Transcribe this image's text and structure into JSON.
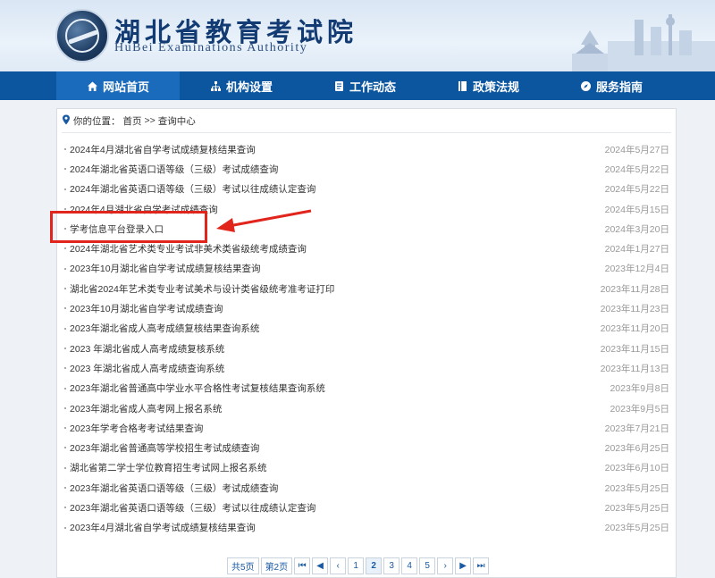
{
  "header": {
    "title": "湖北省教育考试院",
    "subtitle": "HuBei Examinations Authority"
  },
  "nav": {
    "items": [
      {
        "label": "网站首页",
        "icon": "home-icon"
      },
      {
        "label": "机构设置",
        "icon": "org-chart-icon"
      },
      {
        "label": "工作动态",
        "icon": "document-icon"
      },
      {
        "label": "政策法规",
        "icon": "book-icon"
      },
      {
        "label": "服务指南",
        "icon": "compass-icon"
      }
    ],
    "active_index": 0
  },
  "breadcrumb": {
    "prefix": "你的位置：",
    "home": "首页",
    "separator": ">>",
    "current": "查询中心"
  },
  "list": [
    {
      "title": "2024年4月湖北省自学考试成绩复核结果查询",
      "date": "2024年5月27日"
    },
    {
      "title": "2024年湖北省英语口语等级（三级）考试成绩查询",
      "date": "2024年5月22日"
    },
    {
      "title": "2024年湖北省英语口语等级（三级）考试以往成绩认定查询",
      "date": "2024年5月22日"
    },
    {
      "title": "2024年4月湖北省自学考试成绩查询",
      "date": "2024年5月15日"
    },
    {
      "title": "学考信息平台登录入口",
      "date": "2024年3月20日"
    },
    {
      "title": "2024年湖北省艺术类专业考试非美术类省级统考成绩查询",
      "date": "2024年1月27日"
    },
    {
      "title": "2023年10月湖北省自学考试成绩复核结果查询",
      "date": "2023年12月4日"
    },
    {
      "title": "湖北省2024年艺术类专业考试美术与设计类省级统考准考证打印",
      "date": "2023年11月28日"
    },
    {
      "title": "2023年10月湖北省自学考试成绩查询",
      "date": "2023年11月23日"
    },
    {
      "title": "2023年湖北省成人高考成绩复核结果查询系统",
      "date": "2023年11月20日"
    },
    {
      "title": "2023 年湖北省成人高考成绩复核系统",
      "date": "2023年11月15日"
    },
    {
      "title": "2023 年湖北省成人高考成绩查询系统",
      "date": "2023年11月13日"
    },
    {
      "title": "2023年湖北省普通高中学业水平合格性考试复核结果查询系统",
      "date": "2023年9月8日"
    },
    {
      "title": "2023年湖北省成人高考网上报名系统",
      "date": "2023年9月5日"
    },
    {
      "title": "2023年学考合格考考试结果查询",
      "date": "2023年7月21日"
    },
    {
      "title": "2023年湖北省普通高等学校招生考试成绩查询",
      "date": "2023年6月25日"
    },
    {
      "title": "湖北省第二学士学位教育招生考试网上报名系统",
      "date": "2023年6月10日"
    },
    {
      "title": "2023年湖北省英语口语等级（三级）考试成绩查询",
      "date": "2023年5月25日"
    },
    {
      "title": "2023年湖北省英语口语等级（三级）考试以往成绩认定查询",
      "date": "2023年5月25日"
    },
    {
      "title": "2023年4月湖北省自学考试成绩复核结果查询",
      "date": "2023年5月25日"
    }
  ],
  "pagination": {
    "total_pages": "共5页",
    "current_page": "第2页",
    "first": "⏮",
    "prev_group": "◀",
    "prev": "‹",
    "pages": [
      "1",
      "2",
      "3",
      "4",
      "5"
    ],
    "next": "›",
    "next_group": "▶",
    "last": "⏭"
  },
  "colors": {
    "nav_bg": "#0c56a0",
    "nav_active": "#1a6bbb",
    "highlight": "#e1241c",
    "title_color": "#123a73"
  }
}
